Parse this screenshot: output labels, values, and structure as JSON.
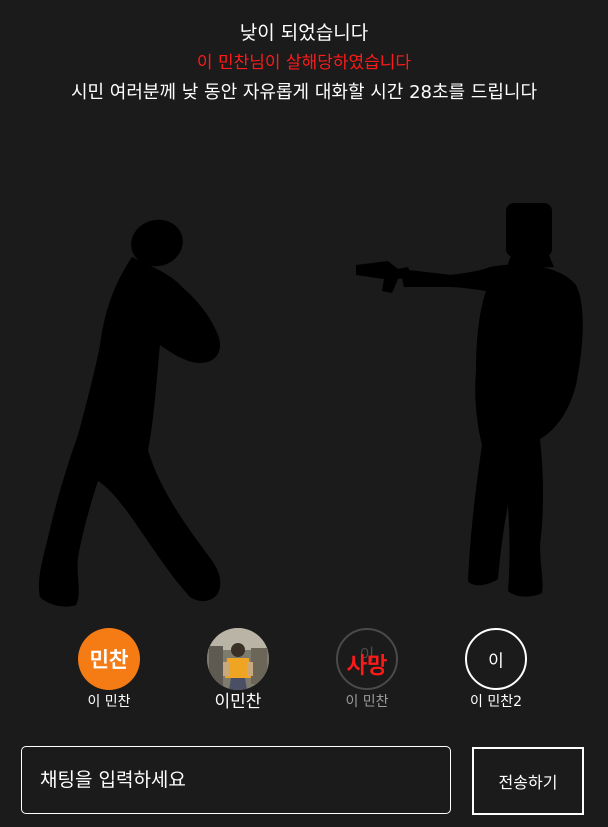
{
  "announcements": {
    "night_title": "낮이 되었습니다",
    "killed_notice": "이 민찬님이 살해당하였습니다",
    "discussion_notice": "시민 여러분께 낮 동안 자유롭게 대화할 시간 28초를 드립니다"
  },
  "colors": {
    "background": "#1b1b1b",
    "alert_red": "#ff1a1a",
    "accent_orange": "#f57b14"
  },
  "players": [
    {
      "avatar_text": "민찬",
      "name": "이 민찬",
      "status": "alive",
      "avatar_style": "orange"
    },
    {
      "avatar_text": "",
      "name": "이민찬",
      "status": "alive",
      "avatar_style": "photo"
    },
    {
      "avatar_text": "이",
      "death_label": "사망",
      "name": "이 민찬",
      "status": "dead",
      "avatar_style": "dead"
    },
    {
      "avatar_text": "이",
      "name": "이 민찬2",
      "status": "alive",
      "avatar_style": "ring"
    }
  ],
  "chat": {
    "placeholder": "채팅을 입력하세요",
    "send_label": "전송하기"
  }
}
